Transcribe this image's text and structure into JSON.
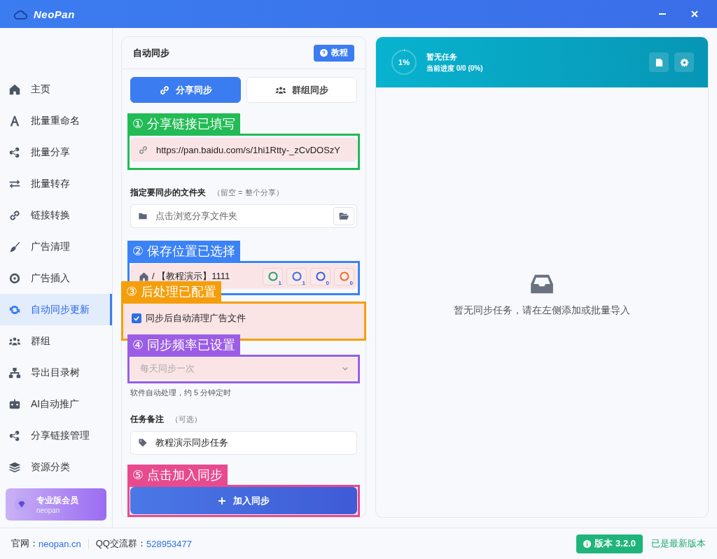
{
  "window": {
    "title": "NeoPan"
  },
  "sidebar": {
    "items": [
      {
        "label": "主页",
        "selected": false
      },
      {
        "label": "批量重命名",
        "selected": false
      },
      {
        "label": "批量分享",
        "selected": false
      },
      {
        "label": "批量转存",
        "selected": false
      },
      {
        "label": "链接转换",
        "selected": false
      },
      {
        "label": "广告清理",
        "selected": false
      },
      {
        "label": "广告插入",
        "selected": false
      },
      {
        "label": "自动同步更新",
        "selected": true
      },
      {
        "label": "群组",
        "selected": false
      },
      {
        "label": "导出目录树",
        "selected": false
      },
      {
        "label": "AI自动推广",
        "selected": false
      },
      {
        "label": "分享链接管理",
        "selected": false
      },
      {
        "label": "资源分类",
        "selected": false
      }
    ],
    "member": {
      "title": "专业版会员",
      "user": "neopan"
    }
  },
  "form": {
    "title": "自动同步",
    "help_button": "教程",
    "mode_tabs": [
      {
        "label": "分享同步",
        "selected": true
      },
      {
        "label": "群组同步",
        "selected": false
      }
    ],
    "link": {
      "value": "https://pan.baidu.com/s/1hi1Rtty-_zCvDOSzY",
      "annotation": {
        "text": "① 分享链接已填写",
        "color": "#22bb55"
      }
    },
    "folder": {
      "label": "指定要同步的文件夹",
      "hint": "（留空 = 整个分享）",
      "placeholder": "点击浏览分享文件夹"
    },
    "save_location": {
      "separator": "/",
      "value": "【教程演示】1111",
      "accounts": [
        {
          "count": "1"
        },
        {
          "count": "1"
        },
        {
          "count": "0"
        },
        {
          "count": "0"
        }
      ],
      "annotation": {
        "text": "② 保存位置已选择",
        "color": "#3b82f6"
      }
    },
    "post_process": {
      "label": "同步后自动清理广告文件",
      "checked": true,
      "annotation": {
        "text": "③ 后处理已配置",
        "color": "#f59e0b"
      }
    },
    "frequency": {
      "value": "每天同步一次",
      "disabled": true,
      "hint": "软件自动处理，约 5 分钟定时",
      "annotation": {
        "text": "④ 同步频率已设置",
        "color": "#9b5de5"
      }
    },
    "note": {
      "label": "任务备注",
      "hint": "（可选）",
      "value": "教程演示同步任务"
    },
    "submit": {
      "label": "加入同步",
      "annotation": {
        "text": "⑤ 点击加入同步",
        "color": "#e84a8f"
      }
    }
  },
  "tasks": {
    "progress": {
      "reading": "1%",
      "level": 0.01
    },
    "title": "暂无任务",
    "subtitle": "当前进度 0/0 (0%)",
    "empty_text": "暂无同步任务，请在左侧添加或批量导入"
  },
  "status_bar": {
    "site_label": "官网：",
    "site_link": "neopan.cn",
    "qq_label": "QQ交流群：",
    "qq_link": "528953477",
    "version": "版本 3.2.0",
    "update_status": "已是最新版本"
  }
}
